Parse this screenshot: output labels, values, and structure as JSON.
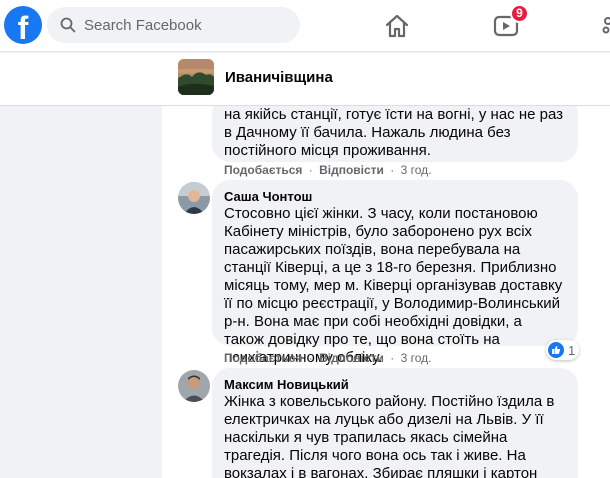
{
  "topbar": {
    "logo_letter": "f",
    "search_placeholder": "Search Facebook",
    "watch_badge": "9",
    "brand_color": "#1877f2"
  },
  "group": {
    "name": "Иваничівщина"
  },
  "comments": [
    {
      "author": "",
      "text": "на якійсь станції, готує їсти на вогні, у нас не раз в Дачному її бачила. Нажаль людина без постійного місця проживання.",
      "like_label": "Подобається",
      "reply_label": "Відповісти",
      "time": "3 год."
    },
    {
      "author": "Саша Чонтош",
      "text": "Стосовно цієї жінки. З часу, коли постановою Кабінету міністрів, було заборонено рух всіх пасажирських поїздів, вона перебувала на станції Ківерці, а це з 18-го березня. Приблизно місяць тому, мер м. Ківерці організував доставку її по місцю реєстрації, у Володимир-Волинський р-н. Вона має при собі необхідні довідки, а також довідку про те, що вона стоїть на психіатричному обліку.",
      "like_label": "Подобається",
      "reply_label": "Відповісти",
      "time": "3 год.",
      "reaction_count": "1"
    },
    {
      "author": "Максим Новицький",
      "text": "Жінка з ковельського району. Постійно їздила в електричках на луцьк або дизелі на Львів. У її наскільки я чув трапилась якась сімейна трагедія. Після чого вона ось так і живе. На вокзалах і в вагонах. Збирає пляшки і картон",
      "like_label": "",
      "reply_label": "",
      "time": ""
    }
  ],
  "separator": "·"
}
